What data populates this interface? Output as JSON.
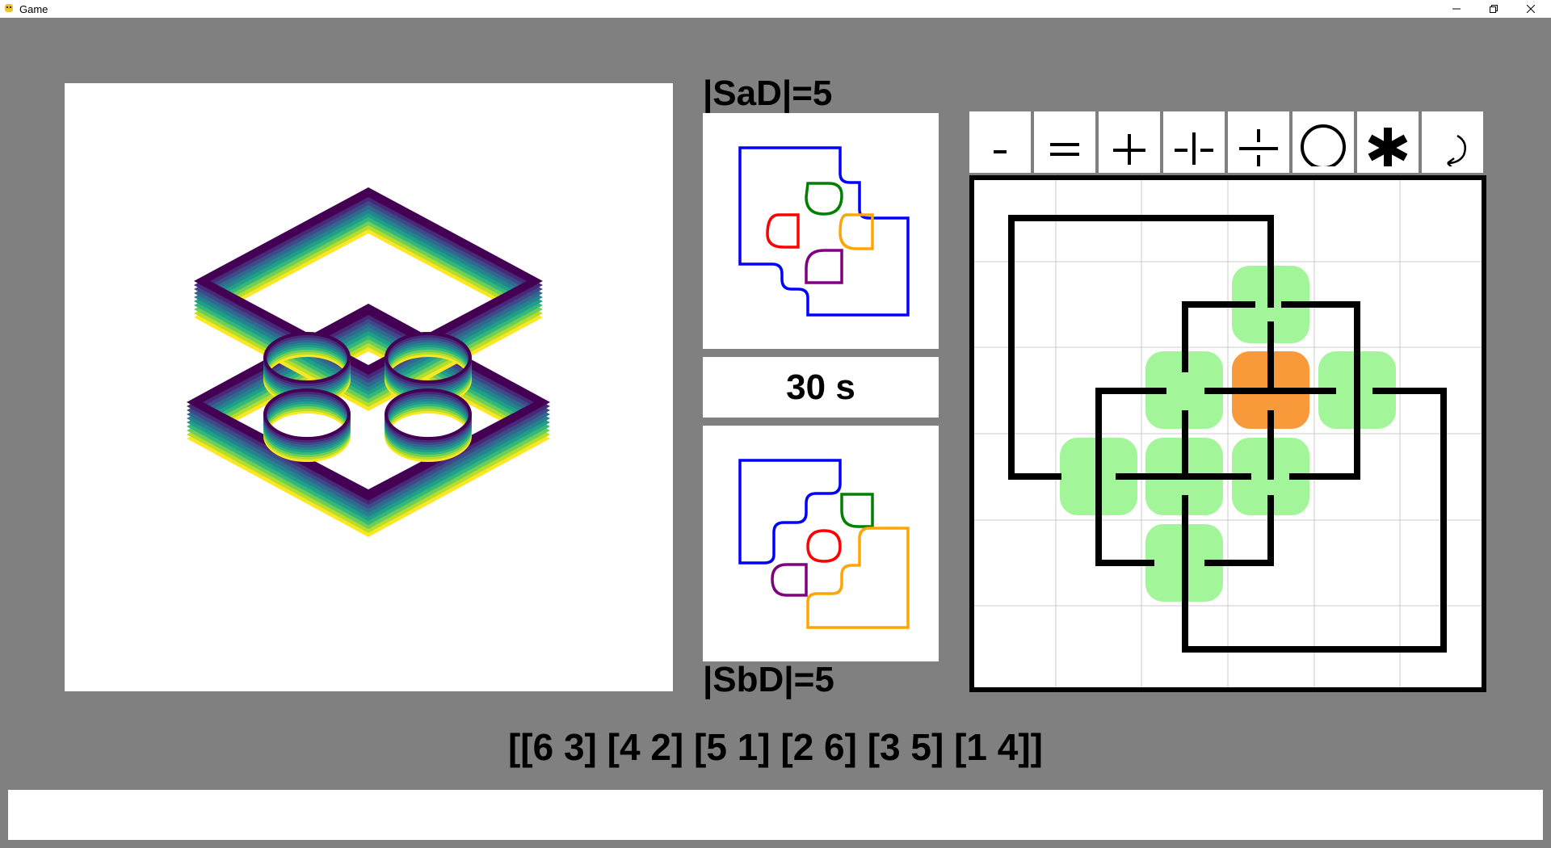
{
  "window": {
    "title": "Game",
    "controls": [
      "minimize-icon",
      "restore-icon",
      "close-icon"
    ]
  },
  "labels": {
    "sad": "|SaD|=5",
    "sbd": "|SbD|=5",
    "timer": "30 s"
  },
  "toolbar": {
    "buttons": [
      {
        "name": "minus-tool",
        "icon": "minus-icon"
      },
      {
        "name": "equals-tool",
        "icon": "equals-icon"
      },
      {
        "name": "plus-tool",
        "icon": "plus-icon"
      },
      {
        "name": "horizontal-cross-tool",
        "icon": "dashed-vertical-cross-icon"
      },
      {
        "name": "vertical-cross-tool",
        "icon": "dashed-horizontal-cross-icon"
      },
      {
        "name": "circle-tool",
        "icon": "circle-icon"
      },
      {
        "name": "asterisk-tool",
        "icon": "asterisk-icon"
      },
      {
        "name": "undo-tool",
        "icon": "undo-arrow-icon"
      }
    ]
  },
  "board": {
    "rows": 6,
    "cols": 6,
    "highlight_colors": {
      "green": "#a3f59a",
      "orange": "#f89a3a"
    }
  },
  "permutation": "[[6 3] [4 2] [5 1] [2 6] [3 5] [1 4]]",
  "colors": {
    "background": "#808080",
    "blue": "#0000ff",
    "green": "#008000",
    "red": "#ff0000",
    "orange": "#ffa500",
    "purple": "#800080"
  }
}
